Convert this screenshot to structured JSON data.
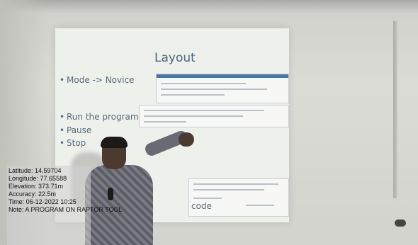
{
  "slide": {
    "title": "Layout",
    "bullets": [
      "Mode -> Novice",
      "Run the program",
      "Pause",
      "Stop"
    ],
    "trailing_text": "code"
  },
  "geotag": {
    "latitude": "Latitude: 14.59704",
    "longitude": "Longitude: 77.65588",
    "elevation": "Elevation: 373.71m",
    "accuracy": "Accuracy: 22.5m",
    "time": "Time: 06-12-2022 10:25",
    "note": "Note: A PROGRAM ON RAPTOR TOOL"
  }
}
